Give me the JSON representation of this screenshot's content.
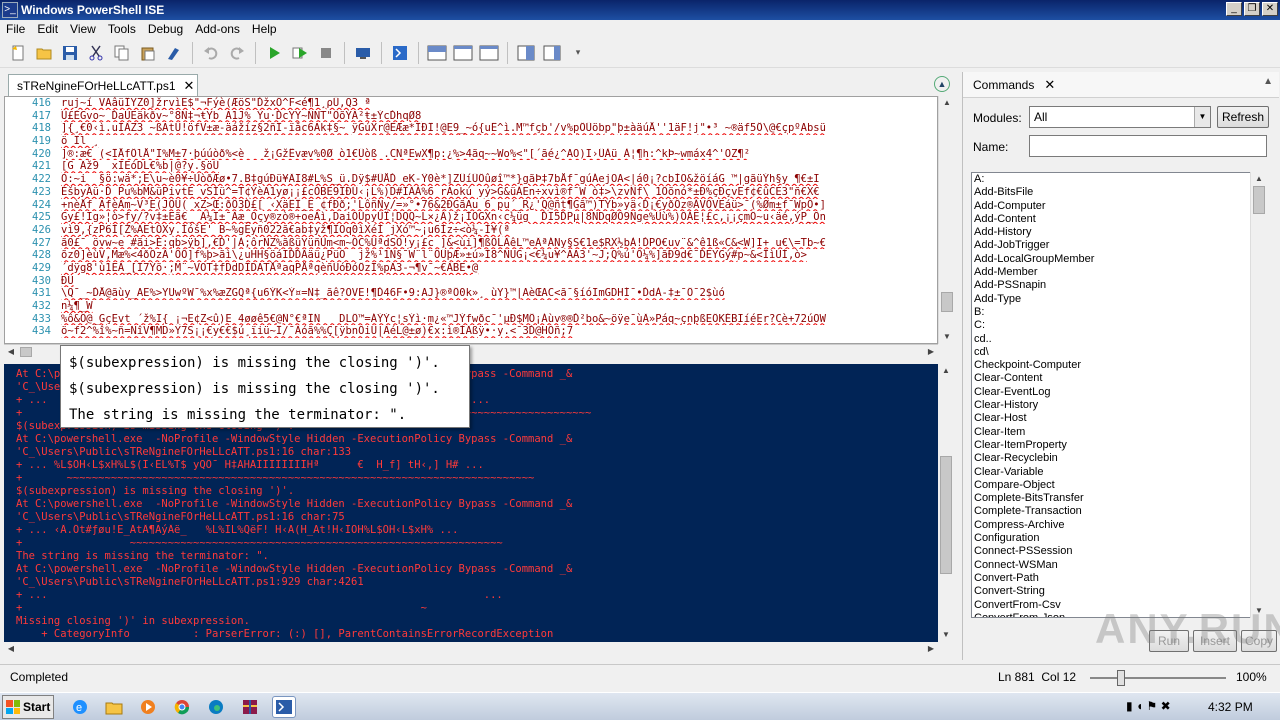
{
  "app": {
    "title": "Windows PowerShell ISE",
    "window_buttons": [
      "_",
      "❐",
      "✕"
    ]
  },
  "menu": [
    "File",
    "Edit",
    "View",
    "Tools",
    "Debug",
    "Add-ons",
    "Help"
  ],
  "toolbar_icons": [
    "new-file-icon",
    "open-folder-icon",
    "save-icon",
    "cut-icon",
    "copy-icon",
    "paste-icon",
    "clear-console-icon",
    "undo-icon",
    "redo-icon",
    "run-icon",
    "run-selection-icon",
    "stop-icon",
    "new-remote-tab-icon",
    "start-powershell-icon",
    "show-script-top-icon",
    "show-script-right-icon",
    "show-script-max-icon",
    "show-command-window-icon",
    "show-command-addon-icon"
  ],
  "tab": {
    "label": "sTReNgineFOrHeLLcATT.ps1",
    "close": "✕"
  },
  "editor": {
    "line_numbers": [
      "416",
      "417",
      "418",
      "419",
      "420",
      "421",
      "422",
      "423",
      "424",
      "425",
      "426",
      "427",
      "428",
      "429",
      "430",
      "431",
      "432",
      "433",
      "434"
    ],
    "lines": [
      "ruj~í VAâüÏYZ0]žrvìE$\"¬Fýè(ÆöS\"ĎžxÖ^F<é¶1¸ρÜ,Q3 ª",
      "Ü£ÈGvo~ ĎaŨEäkðv~°8N‡¬ŧYb A1J% Ÿu·ĎcYY~ÑNT\"ÖõÝÄ²ŧ±ÝcĎhqØ8",
      "]{¸€0‹ì.uÏÄZ3 ~ßAtÜ!öfV±æ-äážíz§2ñÏ-ïåc6Ak‡§~ ÿGúXr@ËÆæ*ÏÐÏ!@E9_~ó{uË^ì.M™fçb'/v%pÖÜöbp\"þ±àäúÅ''1äF!j\"•³ ~®äf5Ô\\@€çpºAbsü",
      "ö Ĩl ¸",
      "]®:æ€ (<ÏÅfÔlÅ\"I%M±7·þúúòð%<è   ž¡GžÊvæv%0Ø ò1€Üòß .CNªEwX¶p:¿%>4ãq~~Wo%<\"[´ãé¿^AO)I›ÜÀü À¦¶h:^kÞ~wmáx4^'OZ¶²",
      "[G Äž9  xIEóDL€%b|@?y.§öÜ",
      "Ò:~i  §ö:wä*;E\\u~è0¥÷ÙòðÆø•7.B‡gúÐü¥ÄI8#L%S_ü.Dÿ$#ÜÅĎ eK-Ÿ0è*]ZÜíÜÖûøî™*}gãÞ‡7bÅf¯gúÁejOA<|á0¡?cbÌO&žöíáG ™|gãüÝh§y ¶€±I",
      "ÉšbyÄü·Ď Pu%bM&üPivtE vSÍü^=T¢ŸèA1yø¡¡£cÒBE9ÏÐÜ‹¡L%)D#ÏÄÁ%6 rAokú yý>G&üÁEn÷xvì®f¯W ò‡>\\zvÑf\\ 1Öõnó*±Ð%çÐçvEf¢€ûCE3\"ñ€X€",
      "+nèÅf ÃfèÄm~V³E(JÖÜ( xZ>Œ:ðÖ3Ď£[ ‹XäËÏ_E ¢fÐð;'LôñÑy/=»°•76&2ÐGãAu 6 pu´_R¿'Q@ñt¶Gã™)TÝb»yä‹Ď¡€yðÖz®ÁVÖVEáü>¯(%Øm±f¯WpÖ•]",
      "Gy£!Ig»¦ò>fy/?v‡±Eã€_ Ä¼I±¯Äæ_Oçy®zò®+oeÄì,DaiÖÜpyÜÎ¦DQQ~L×¿Ä)ž¡ÌÕGXn‹c¼üg  ĎI5ĎPµ|8NDqØÖ9Nge%Üù%)ÖÁE¦£c,¡¡çmÖ~u‹äé,ýP_Ön",
      "vì9,{zP6Ì[Ž%ÄEtÖXy.ÍóšE' B~%gEyñ022ã€ab‡yž¶ÏOq0ìXéÌ jXó™~¡u6Ìz÷<ò¼-Ì¥(ª",
      "ã0£¯ övw~e #ãi>È:qb>ÿb],€Ď'|À;ôrÑZ%ãßüYüñÛm<m~ÖC%ÜªdSÖ!y¡£c ]&<ùi]¶ßÖLÄêL™eÄªÁNy§S€1e$RX½bÀ!ĎPO€uv¨&^ê1ß«C&<W]I+ u€\\=Tb~€",
      "õz0]èùV,Mæ%<4ðÖzÄ'ÖÖ]f%þ>ãì\\¿uHH§öáIĎĎÄäü¿PüÖ  jž%¹1Ñ§¯W¨l¨ÖÜþÆ»±ú»Ï8^ÑUG¡<€¼u¥^AA3'~J;Q%ú'Ö¼%]ãÐ9d€¯ĎEYGý#p~&<ÎìÚÍ,ò>",
      "´dÿg8'ù1EÄ_[Ï7Ýõ·;M¨~VOT‡fDdDÏDATÅªaqPÅªqèñÜóÐóÖzÏ%pÄ3-¬¶v¯~€ÄBE•@",
      "ÐÜ",
      "\\Q¯_~ĎÅ@ãùy_AE%>YUwºW¯%x%æZGQª{u6ÝK<Ý¤=Ñ‡_ãê?OVE!¶Ď46F•9:AJ}®ªÖ0k»¸ ùY}™|AèŒAC<ã¯§íóImGDHÍ¯•ĎdÀ-‡±¯Ö¯2$ùó",
      "n¼¶_W",
      "%ô&Ö@_GçEvt ´ž%I{ ¡¬E¢Z<û)E 4øøê5€@Ñ°€ªÏÑ   DLÖ™=ÁÝÝc¦sÝì·m¿«™JÝfwðc¯'µÐ$MÔ¡Áùv®®Ď²bo&~öÿe¯ùÄ»Páq~çnþßEÖKÉBIíéEr?Cè+72úOW",
      "ö~f2^%î%~ñ=ÑîV¶MD»Y7S¡¡€y€€$ú¸ïiü~Ï/¯Äóã%%Ç[ÿbnÖiÜ|ÃéL@±ø)€x:ì®ÍÄßÿ•·y.<¯3Ď@HÕñ;7"
    ]
  },
  "tooltip": {
    "lines": [
      "$(subexpression) is missing the closing ')'.",
      "$(subexpression) is missing the closing ')'.",
      "The string is missing the terminator: \"."
    ]
  },
  "console": {
    "lines": [
      "At C:\\powershell.exe  -NoProfile -WindowStyle Hidden -ExecutionPolicy Bypass -Command _&",
      "'C_\\Users\\Public\\sTReNgineFOrHeLLcATT.ps1:16 char:133",
      "+ ...                                                               ]ÄI ...",
      "+                                                       ~~~~~~~~~~~~~~~~~~~~~~~~~~~~~~~~~~~",
      "$(subexpression) is missing the closing ')'.",
      "At C:\\powershell.exe  -NoProfile -WindowStyle Hidden -ExecutionPolicy Bypass -Command _&",
      "'C_\\Users\\Public\\sTReNgineFOrHeLLcATT.ps1:16 char:133",
      "+ ... %L$OH‹L$xH%L$(I‹EL%T$ yQÖ¯ H‡AHAIIIIIIIIHª      €  H_f] tH‹,] H# ...",
      "+       ~~~~~~~~~~~~~~~~~~~~~~~~~~~~~~~~~~~~~~~~~~~~~~~~~~~~~~~~~~~~~~~~~~~~~~~~~~",
      "$(subexpression) is missing the closing ')'.",
      "At C:\\powershell.exe  -NoProfile -WindowStyle Hidden -ExecutionPolicy Bypass -Command _&",
      "'C_\\Users\\Public\\sTReNgineFOrHeLLcATT.ps1:16 char:75",
      "+ ... ‹Ä.Öt#ƒøu!E_ÄtÄ¶ÃýÄë_   %L%IL%QëF! H‹A(H_At!H‹IOH%L$OH‹L$xH% ...",
      "+                 ~~~~~~~~~~~~~~~~~~~~~~~~~~~~~~~~~~~~~~~~~~~~~~~~~~~~~~~~~~~",
      "The string is missing the terminator: \".",
      "At C:\\powershell.exe  -NoProfile -WindowStyle Hidden -ExecutionPolicy Bypass -Command _&",
      "'C_\\Users\\Public\\sTReNgineFOrHeLLcATT.ps1:929 char:4261",
      "+ ...                                                                     ...",
      "+                                                               ~",
      "Missing closing ')' in subexpression.",
      "    + CategoryInfo          : ParserError: (:) [], ParentContainsErrorRecordException"
    ]
  },
  "commands": {
    "header": "Commands",
    "close": "✕",
    "modules_label": "Modules:",
    "modules_value": "All",
    "refresh_label": "Refresh",
    "name_label": "Name:",
    "items": [
      "A:",
      "Add-BitsFile",
      "Add-Computer",
      "Add-Content",
      "Add-History",
      "Add-JobTrigger",
      "Add-LocalGroupMember",
      "Add-Member",
      "Add-PSSnapin",
      "Add-Type",
      "B:",
      "C:",
      "cd..",
      "cd\\",
      "Checkpoint-Computer",
      "Clear-Content",
      "Clear-EventLog",
      "Clear-History",
      "Clear-Host",
      "Clear-Item",
      "Clear-ItemProperty",
      "Clear-Recyclebin",
      "Clear-Variable",
      "Compare-Object",
      "Complete-BitsTransfer",
      "Complete-Transaction",
      "Compress-Archive",
      "Configuration",
      "Connect-PSSession",
      "Connect-WSMan",
      "Convert-Path",
      "Convert-String",
      "ConvertFrom-Csv",
      "ConvertFrom-Json"
    ],
    "run_label": "Run",
    "insert_label": "Insert",
    "copy_label": "Copy"
  },
  "watermark": "ANY.RUN",
  "status": {
    "text": "Completed",
    "position": "Ln 881  Col 12",
    "zoom": "100%",
    "zoom_level": 0.2
  },
  "taskbar": {
    "start_label": "Start",
    "apps": [
      "ie-icon",
      "explorer-icon",
      "media-player-icon",
      "chrome-icon",
      "edge-icon",
      "winrar-icon",
      "powershell-ise-icon"
    ],
    "clock": "4:32 PM"
  },
  "colors": {
    "console_bg": "#012456",
    "error_text": "#ff3a3a",
    "editor_text": "#8b0000",
    "line_number": "#2b91af",
    "titlebar": "#0a246a"
  }
}
